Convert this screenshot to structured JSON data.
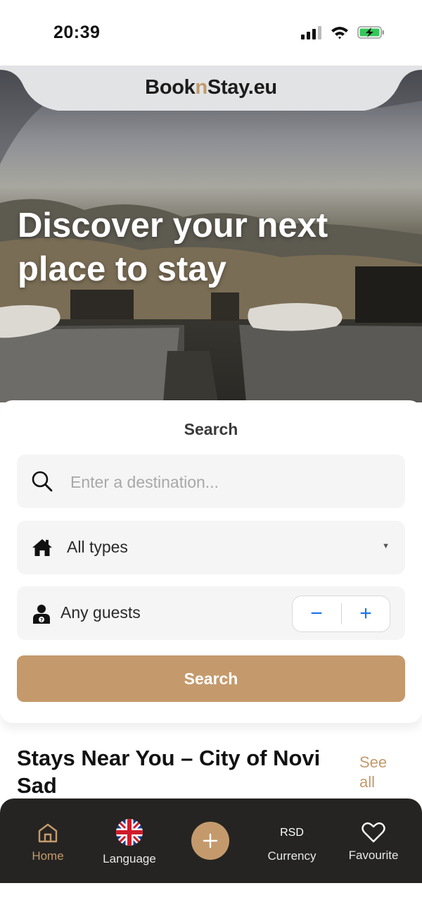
{
  "status_bar": {
    "time": "20:39",
    "icons": [
      "cellular-signal-icon",
      "wifi-icon",
      "battery-charging-icon"
    ]
  },
  "header": {
    "logo_part1": "Book",
    "logo_accent": "n",
    "logo_part2": "Stay.eu"
  },
  "hero": {
    "title": "Discover your next place to stay"
  },
  "search": {
    "title": "Search",
    "destination_placeholder": "Enter a destination...",
    "destination_value": "",
    "type_selected": "All types",
    "guests_label": "Any guests",
    "decrement_symbol": "−",
    "increment_symbol": "+",
    "button_label": "Search"
  },
  "section": {
    "title": "Stays Near You – City of Novi Sad",
    "see_all": "See all"
  },
  "bottom_nav": {
    "items": [
      {
        "label": "Home",
        "icon": "home-icon",
        "active": true
      },
      {
        "label": "Language",
        "icon": "uk-flag-icon"
      },
      {
        "label": "",
        "icon": "plus-icon"
      },
      {
        "label": "Currency",
        "icon_text": "RSD"
      },
      {
        "label": "Favourite",
        "icon": "heart-icon"
      }
    ]
  },
  "colors": {
    "accent": "#c49a6c",
    "nav_background": "#252422",
    "stepper_blue": "#1a73e8"
  }
}
